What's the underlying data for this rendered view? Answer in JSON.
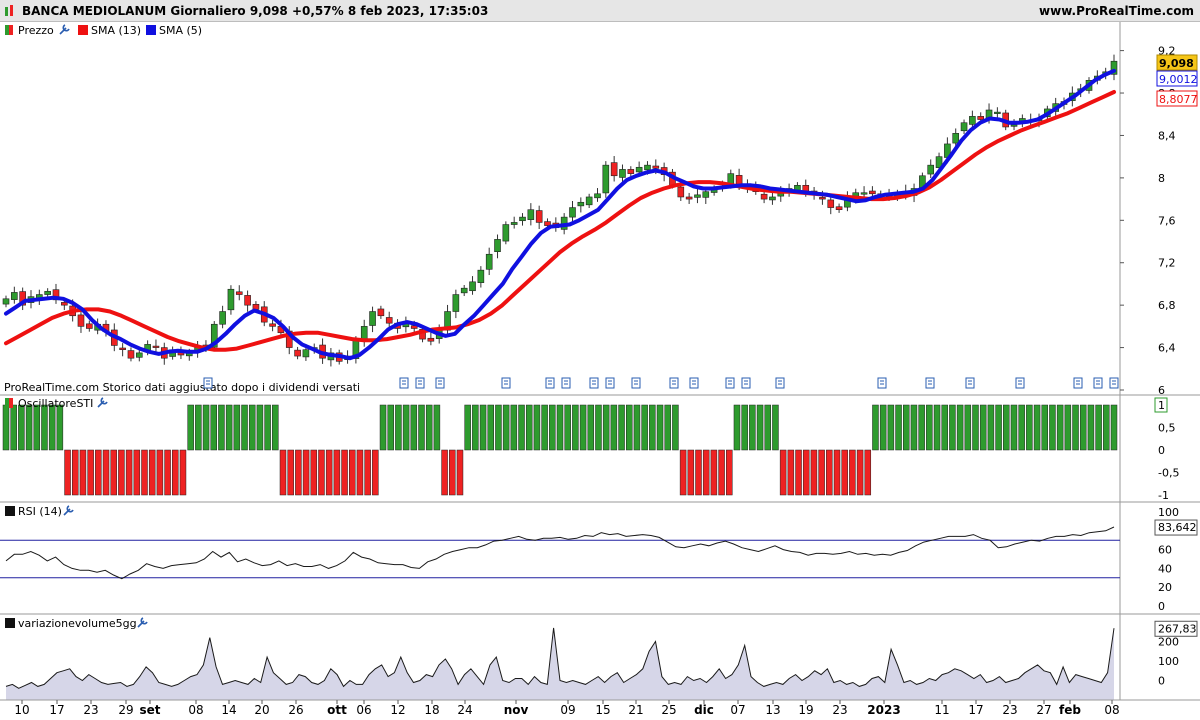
{
  "header": {
    "title": "BANCA MEDIOLANUM Giornaliero 9,098 +0,57% 8 feb 2023, 17:35:03",
    "site": "www.ProRealTime.com"
  },
  "legend": {
    "price": "Prezzo",
    "sma13": "SMA (13)",
    "sma5": "SMA (5)"
  },
  "notice": "ProRealTime.com  Storico dati aggiustato dopo i dividendi versati",
  "colors": {
    "up": "#2e9b2e",
    "down": "#ee2222",
    "sma13": "#ee1111",
    "sma5": "#1010e0",
    "rsi_line": "#1a1a1a",
    "volume_line": "#1a1a1a",
    "volume_fill": "#d6d6e8",
    "ref_line": "#2020a0"
  },
  "icons": [
    "wrench-icon",
    "document-icon"
  ],
  "chart_data": [
    {
      "type": "candlestick",
      "title": "BANCA MEDIOLANUM Giornaliero",
      "ylim": [
        6.0,
        9.3
      ],
      "yticks": [
        "6",
        "6,4",
        "6,8",
        "7,2",
        "7,6",
        "8",
        "8,4",
        "8,8",
        "9,2"
      ],
      "last_value_labels": {
        "price": "9,098",
        "sma5": "9,0012",
        "sma13": "8,8077"
      },
      "close": [
        6.86,
        6.92,
        6.8,
        6.88,
        6.9,
        6.93,
        6.85,
        6.8,
        6.7,
        6.6,
        6.58,
        6.62,
        6.55,
        6.42,
        6.38,
        6.3,
        6.35,
        6.43,
        6.4,
        6.3,
        6.38,
        6.33,
        6.35,
        6.4,
        6.42,
        6.62,
        6.74,
        6.95,
        6.9,
        6.8,
        6.76,
        6.64,
        6.6,
        6.54,
        6.4,
        6.32,
        6.38,
        6.4,
        6.3,
        6.35,
        6.27,
        6.32,
        6.47,
        6.6,
        6.74,
        6.7,
        6.63,
        6.58,
        6.63,
        6.58,
        6.48,
        6.46,
        6.58,
        6.74,
        6.9,
        6.96,
        7.02,
        7.13,
        7.28,
        7.42,
        7.56,
        7.58,
        7.63,
        7.7,
        7.58,
        7.55,
        7.53,
        7.63,
        7.72,
        7.77,
        7.82,
        7.85,
        8.12,
        8.02,
        8.08,
        8.04,
        8.1,
        8.12,
        8.09,
        8.03,
        7.93,
        7.82,
        7.8,
        7.84,
        7.87,
        7.9,
        7.92,
        8.04,
        7.94,
        7.92,
        7.87,
        7.8,
        7.82,
        7.86,
        7.9,
        7.93,
        7.86,
        7.84,
        7.8,
        7.72,
        7.7,
        7.82,
        7.86,
        7.86,
        7.85,
        7.85,
        7.82,
        7.85,
        7.85,
        7.9,
        8.02,
        8.12,
        8.2,
        8.32,
        8.42,
        8.52,
        8.58,
        8.55,
        8.64,
        8.62,
        8.48,
        8.5,
        8.56,
        8.54,
        8.56,
        8.65,
        8.7,
        8.72,
        8.8,
        8.84,
        8.92,
        8.96,
        9.0,
        9.1
      ],
      "sma5": [
        6.72,
        6.78,
        6.84,
        6.85,
        6.86,
        6.87,
        6.86,
        6.82,
        6.76,
        6.66,
        6.58,
        6.52,
        6.48,
        6.43,
        6.39,
        6.36,
        6.34,
        6.36,
        6.37,
        6.36,
        6.36,
        6.39,
        6.45,
        6.53,
        6.62,
        6.7,
        6.75,
        6.72,
        6.68,
        6.6,
        6.5,
        6.43,
        6.39,
        6.35,
        6.33,
        6.32,
        6.3,
        6.33,
        6.4,
        6.48,
        6.57,
        6.62,
        6.64,
        6.62,
        6.58,
        6.54,
        6.51,
        6.53,
        6.62,
        6.7,
        6.8,
        6.9,
        7.0,
        7.14,
        7.26,
        7.38,
        7.48,
        7.54,
        7.55,
        7.56,
        7.6,
        7.65,
        7.7,
        7.8,
        7.9,
        7.98,
        8.02,
        8.05,
        8.07,
        8.05,
        8.0,
        7.96,
        7.92,
        7.9,
        7.9,
        7.91,
        7.92,
        7.93,
        7.93,
        7.92,
        7.9,
        7.89,
        7.88,
        7.87,
        7.86,
        7.85,
        7.84,
        7.82,
        7.8,
        7.78,
        7.79,
        7.82,
        7.84,
        7.85,
        7.86,
        7.87,
        7.9,
        7.98,
        8.1,
        8.22,
        8.35,
        8.45,
        8.52,
        8.56,
        8.55,
        8.52,
        8.52,
        8.53,
        8.55,
        8.6,
        8.66,
        8.72,
        8.78,
        8.85,
        8.92,
        8.97,
        9.01
      ],
      "sma13": [
        6.44,
        6.5,
        6.56,
        6.62,
        6.68,
        6.72,
        6.75,
        6.76,
        6.76,
        6.74,
        6.7,
        6.65,
        6.6,
        6.55,
        6.5,
        6.46,
        6.43,
        6.4,
        6.38,
        6.38,
        6.39,
        6.42,
        6.45,
        6.48,
        6.51,
        6.53,
        6.54,
        6.54,
        6.52,
        6.5,
        6.48,
        6.47,
        6.47,
        6.48,
        6.5,
        6.52,
        6.55,
        6.57,
        6.58,
        6.59,
        6.62,
        6.66,
        6.72,
        6.8,
        6.9,
        7.0,
        7.1,
        7.2,
        7.3,
        7.38,
        7.45,
        7.51,
        7.58,
        7.66,
        7.74,
        7.81,
        7.86,
        7.9,
        7.93,
        7.95,
        7.96,
        7.96,
        7.95,
        7.93,
        7.91,
        7.89,
        7.88,
        7.87,
        7.87,
        7.86,
        7.85,
        7.84,
        7.83,
        7.82,
        7.81,
        7.8,
        7.8,
        7.81,
        7.83,
        7.86,
        7.91,
        7.98,
        8.06,
        8.14,
        8.22,
        8.29,
        8.35,
        8.4,
        8.45,
        8.49,
        8.53,
        8.57,
        8.61,
        8.66,
        8.71,
        8.76,
        8.81
      ]
    },
    {
      "type": "bar",
      "title": "OscillatoreSTI",
      "ylim": [
        -1,
        1
      ],
      "yticks": [
        "1",
        "0,5",
        "0",
        "-0,5",
        "-1"
      ],
      "last_value_label": "1",
      "values": [
        1,
        1,
        1,
        1,
        1,
        1,
        1,
        1,
        -1,
        -1,
        -1,
        -1,
        -1,
        -1,
        -1,
        -1,
        -1,
        -1,
        -1,
        -1,
        -1,
        -1,
        -1,
        -1,
        1,
        1,
        1,
        1,
        1,
        1,
        1,
        1,
        1,
        1,
        1,
        1,
        -1,
        -1,
        -1,
        -1,
        -1,
        -1,
        -1,
        -1,
        -1,
        -1,
        -1,
        -1,
        -1,
        1,
        1,
        1,
        1,
        1,
        1,
        1,
        1,
        -1,
        -1,
        -1,
        1,
        1,
        1,
        1,
        1,
        1,
        1,
        1,
        1,
        1,
        1,
        1,
        1,
        1,
        1,
        1,
        1,
        1,
        1,
        1,
        1,
        1,
        1,
        1,
        1,
        1,
        1,
        1,
        -1,
        -1,
        -1,
        -1,
        -1,
        -1,
        -1,
        1,
        1,
        1,
        1,
        1,
        1,
        -1,
        -1,
        -1,
        -1,
        -1,
        -1,
        -1,
        -1,
        -1,
        -1,
        -1,
        -1,
        1,
        1,
        1,
        1,
        1,
        1,
        1,
        1,
        1,
        1,
        1,
        1,
        1,
        1,
        1,
        1,
        1,
        1,
        1,
        1,
        1,
        1,
        1,
        1,
        1,
        1,
        1,
        1,
        1,
        1,
        1,
        1
      ]
    },
    {
      "type": "line",
      "title": "RSI (14)",
      "ylim": [
        0,
        100
      ],
      "yticks": [
        "100",
        "80",
        "60",
        "40",
        "20",
        "0"
      ],
      "reference_lines": [
        70,
        30
      ],
      "last_value_label": "83,642",
      "values": [
        48,
        55,
        55,
        58,
        54,
        48,
        52,
        44,
        40,
        38,
        38,
        36,
        38,
        33,
        29,
        34,
        38,
        45,
        42,
        40,
        43,
        44,
        45,
        46,
        50,
        58,
        52,
        57,
        47,
        50,
        46,
        43,
        44,
        48,
        43,
        45,
        42,
        42,
        44,
        40,
        43,
        48,
        57,
        52,
        50,
        46,
        45,
        44,
        44,
        41,
        40,
        47,
        50,
        55,
        58,
        60,
        62,
        62,
        65,
        69,
        70,
        72,
        74,
        71,
        70,
        72,
        72,
        73,
        71,
        72,
        75,
        74,
        78,
        76,
        77,
        74,
        75,
        76,
        75,
        73,
        68,
        63,
        62,
        64,
        66,
        64,
        67,
        69,
        66,
        62,
        60,
        58,
        61,
        64,
        60,
        58,
        57,
        54,
        56,
        56,
        55,
        56,
        58,
        55,
        56,
        54,
        55,
        54,
        57,
        59,
        64,
        68,
        70,
        72,
        74,
        74,
        74,
        76,
        72,
        70,
        62,
        63,
        66,
        68,
        70,
        69,
        72,
        74,
        74,
        76,
        75,
        78,
        79,
        80,
        84
      ]
    },
    {
      "type": "area",
      "title": "variazionevolume5gg",
      "ylim": [
        -100,
        300
      ],
      "yticks": [
        "267,83",
        "200",
        "100",
        "0"
      ],
      "last_value_label": "267,83",
      "values": [
        -30,
        -20,
        -40,
        -25,
        -10,
        -30,
        -20,
        10,
        40,
        50,
        60,
        20,
        0,
        30,
        10,
        -10,
        -20,
        -15,
        -10,
        -30,
        -20,
        20,
        70,
        40,
        -10,
        -20,
        -30,
        -20,
        0,
        20,
        30,
        80,
        220,
        70,
        -20,
        -10,
        0,
        -10,
        -20,
        10,
        -10,
        120,
        40,
        10,
        -20,
        -10,
        30,
        20,
        -10,
        -20,
        0,
        60,
        30,
        -30,
        0,
        -20,
        -20,
        30,
        60,
        80,
        20,
        40,
        120,
        40,
        -10,
        0,
        30,
        20,
        80,
        110,
        60,
        -20,
        30,
        60,
        20,
        -20,
        80,
        120,
        0,
        -10,
        10,
        10,
        -20,
        20,
        -10,
        -20,
        270,
        0,
        -10,
        0,
        -10,
        -20,
        0,
        20,
        -10,
        20,
        40,
        -10,
        10,
        30,
        60,
        150,
        200,
        20,
        -20,
        -10,
        -20,
        20,
        0,
        10,
        -10,
        20,
        60,
        10,
        30,
        80,
        180,
        20,
        -10,
        -30,
        -20,
        -10,
        -20,
        10,
        30,
        0,
        20,
        50,
        30,
        60,
        -10,
        0,
        -20,
        -10,
        -30,
        -20,
        10,
        20,
        -10,
        160,
        80,
        -10,
        0,
        -20,
        -10,
        10,
        0,
        30,
        40,
        60,
        50,
        30,
        10,
        30,
        -10,
        0,
        20,
        -10,
        0,
        10,
        40,
        60,
        80,
        50,
        40,
        -20,
        70,
        -10,
        30,
        20,
        10,
        0,
        -10,
        40,
        268
      ]
    }
  ],
  "x_axis": {
    "labels": [
      "10",
      "17",
      "23",
      "29",
      "set",
      "08",
      "14",
      "20",
      "26",
      "ott",
      "06",
      "12",
      "18",
      "24",
      "nov",
      "09",
      "15",
      "21",
      "25",
      "dic",
      "07",
      "13",
      "19",
      "23",
      "2023",
      "11",
      "17",
      "23",
      "27",
      "feb",
      "08"
    ],
    "bold": [
      "set",
      "ott",
      "nov",
      "dic",
      "2023",
      "feb"
    ]
  },
  "divider_positions_note": ""
}
